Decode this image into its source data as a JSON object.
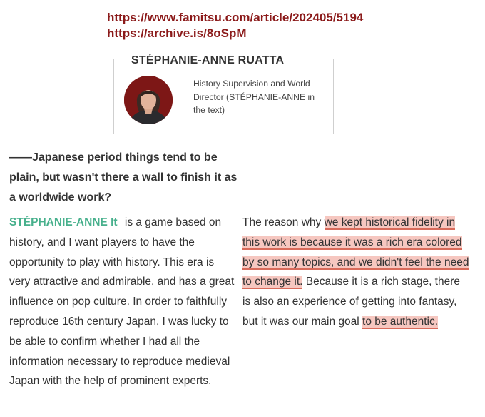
{
  "links": {
    "url1": "https://www.famitsu.com/article/202405/5194",
    "url2": "https://archive.is/8oSpM"
  },
  "profile": {
    "name": "STÉPHANIE-ANNE RUATTA",
    "role": "History Supervision and World Director (STÉPHANIE-ANNE in the text)"
  },
  "question": "——Japanese period things tend to be plain, but wasn't there a wall to finish it as a worldwide work?",
  "answer_left": {
    "speaker": "STÉPHANIE-ANNE It",
    "text": " is a game based on history, and I want players to have the opportunity to play with history. This era is very attractive and admirable, and has a great influence on pop culture. In order to faithfully reproduce 16th century Japan, I was lucky to be able to confirm whether I had all the information necessary to reproduce medieval Japan with the help of prominent experts."
  },
  "answer_right": {
    "lead": "The reason why ",
    "highlight1": "we kept historical fidelity in this work is because it was a rich era colored by so many topics, and we didn't feel the need to change it.",
    "middle": " Because it is a rich stage, there is also an experience of getting into fantasy, but it was our main goal ",
    "highlight2": "to be authentic."
  },
  "colors": {
    "link": "#8b1a1a",
    "speaker": "#47b08c",
    "highlight_fill": "#f6c7c0",
    "highlight_underline": "#d96b5b"
  }
}
